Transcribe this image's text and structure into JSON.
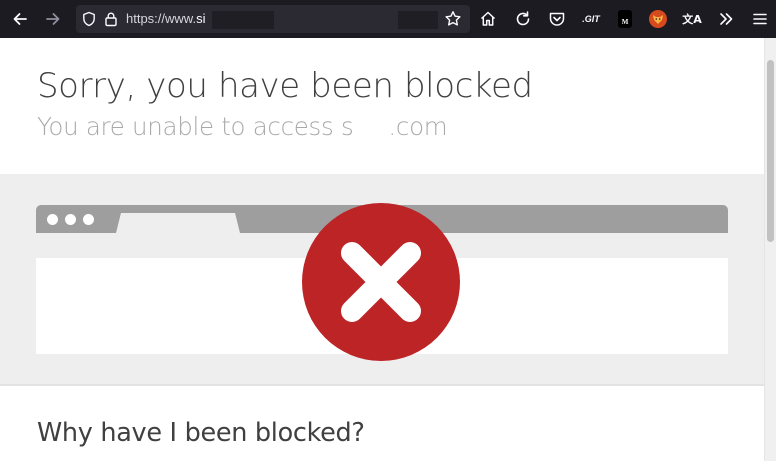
{
  "browser": {
    "url_scheme": "https://www.",
    "url_host_visible": "si",
    "icons": {
      "back": "arrow-left-icon",
      "forward": "arrow-right-icon",
      "tracking": "shield-icon",
      "security": "lock-icon",
      "bookmark": "star-icon",
      "home": "home-icon",
      "reload": "reload-icon",
      "pocket": "pocket-icon",
      "overflow": "chevron-double-right-icon",
      "menu": "hamburger-menu-icon"
    },
    "extensions": [
      "git-extension-icon",
      "m-extension-icon",
      "fox-extension-icon",
      "translate-extension-icon"
    ],
    "extension_git_label": ".GIT",
    "extension_m_label": "M",
    "extension_translate_label": "文A"
  },
  "page": {
    "title": "Sorry, you have been blocked",
    "subtitle_before": "You are unable to access s",
    "subtitle_after": ".com",
    "section_heading": "Why have I been blocked?"
  },
  "colors": {
    "error_red": "#bd2426",
    "toolbar_bg": "#1c1b22",
    "illustration_bg": "#eeeeee"
  }
}
